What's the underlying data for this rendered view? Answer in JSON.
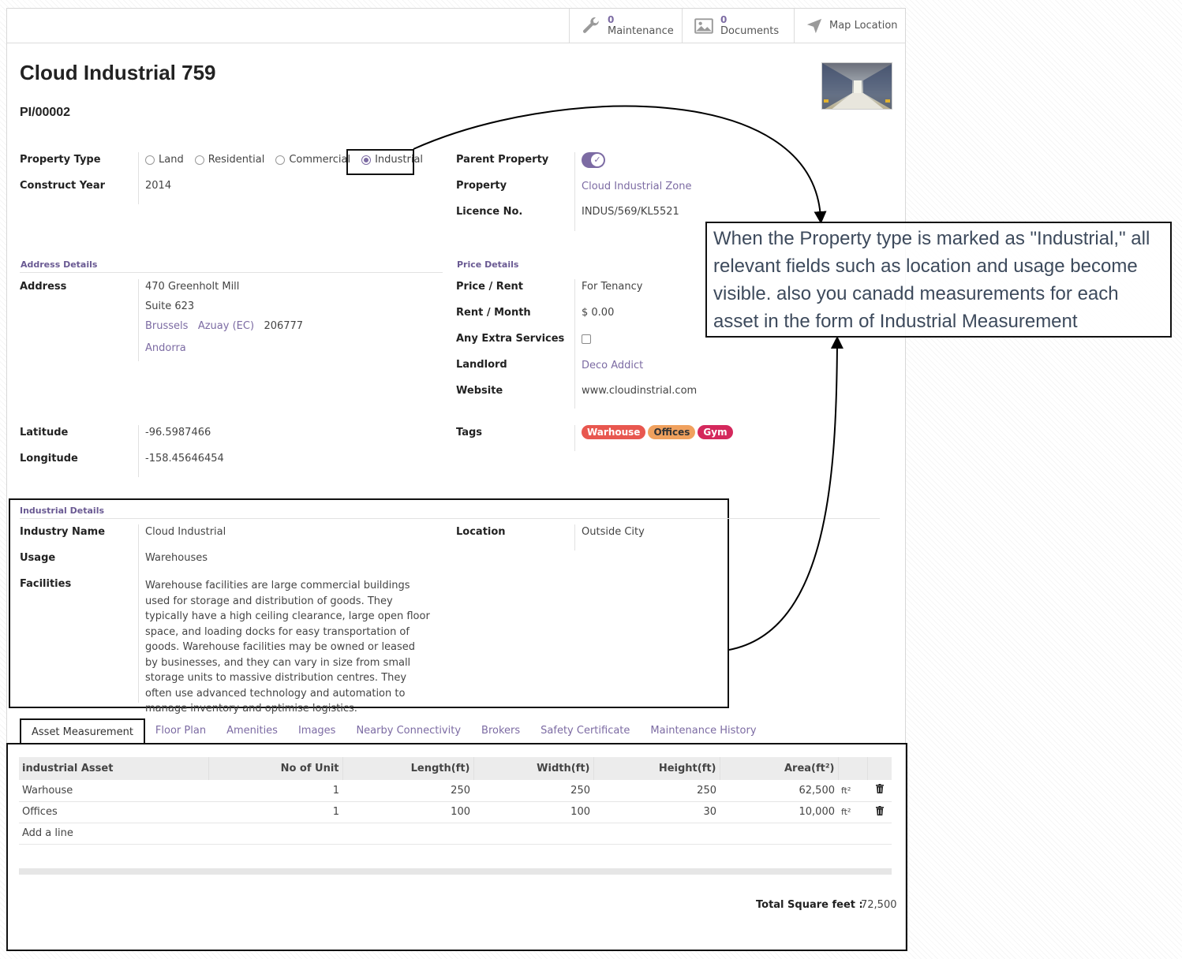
{
  "smart_buttons": [
    {
      "count": "0",
      "label": "Maintenance",
      "icon": "wrench-icon"
    },
    {
      "count": "0",
      "label": "Documents",
      "icon": "image-icon"
    },
    {
      "count": "",
      "label": "Map Location",
      "icon": "location-arrow-icon"
    }
  ],
  "record": {
    "title": "Cloud Industrial 759",
    "reference": "PI/00002"
  },
  "fields": {
    "property_type_label": "Property Type",
    "property_type_options": [
      "Land",
      "Residential",
      "Commercial",
      "Industrial"
    ],
    "property_type_selected": "Industrial",
    "construct_year_label": "Construct Year",
    "construct_year": "2014",
    "parent_property_label": "Parent Property",
    "property_label": "Property",
    "property": "Cloud Industrial Zone",
    "licence_label": "Licence No.",
    "licence": "INDUS/569/KL5521"
  },
  "address": {
    "section": "Address Details",
    "label": "Address",
    "street": "470 Greenholt Mill",
    "street2": "Suite 623",
    "city": "Brussels",
    "state": "Azuay (EC)",
    "zip": "206777",
    "country": "Andorra",
    "latitude_label": "Latitude",
    "latitude": "-96.5987466",
    "longitude_label": "Longitude",
    "longitude": "-158.45646454"
  },
  "price": {
    "section": "Price Details",
    "price_rent_label": "Price / Rent",
    "price_rent": "For Tenancy",
    "rent_month_label": "Rent / Month",
    "rent_month": "$ 0.00",
    "extra_label": "Any Extra Services",
    "landlord_label": "Landlord",
    "landlord": "Deco Addict",
    "website_label": "Website",
    "website": "www.cloudinstrial.com",
    "tags_label": "Tags",
    "tags": [
      {
        "name": "Warhouse",
        "bg": "#e8574f",
        "fg": "#ffffff"
      },
      {
        "name": "Offices",
        "bg": "#f0a15e",
        "fg": "#333333"
      },
      {
        "name": "Gym",
        "bg": "#d4285c",
        "fg": "#ffffff"
      }
    ]
  },
  "industrial": {
    "section": "Industrial Details",
    "industry_name_label": "Industry Name",
    "industry_name": "Cloud Industrial",
    "usage_label": "Usage",
    "usage": "Warehouses",
    "facilities_label": "Facilities",
    "facilities": "Warehouse facilities are large commercial buildings used for storage and distribution of goods. They typically have a high ceiling clearance, large open floor space, and loading docks for easy transportation of goods. Warehouse facilities may be owned or leased by businesses, and they can vary in size from small storage units to massive distribution centres. They often use advanced technology and automation to manage inventory and optimise logistics.",
    "location_label": "Location",
    "location": "Outside City"
  },
  "tabs": [
    "Asset Measurement",
    "Floor Plan",
    "Amenities",
    "Images",
    "Nearby Connectivity",
    "Brokers",
    "Safety Certificate",
    "Maintenance History"
  ],
  "table": {
    "headers": [
      "industrial Asset",
      "No of Unit",
      "Length(ft)",
      "Width(ft)",
      "Height(ft)",
      "Area(ft²)"
    ],
    "rows": [
      {
        "asset": "Warhouse",
        "units": "1",
        "length": "250",
        "width": "250",
        "height": "250",
        "area": "62,500",
        "unit": "ft²"
      },
      {
        "asset": "Offices",
        "units": "1",
        "length": "100",
        "width": "100",
        "height": "30",
        "area": "10,000",
        "unit": "ft²"
      }
    ],
    "add_line": "Add a line"
  },
  "total": {
    "label": "Total Square feet :",
    "value": "72,500"
  },
  "annotation": "When the Property type is marked as \"Industrial,\" all relevant fields such as location and usage become visible. also you canadd measurements for each asset in the form of Industrial Measurement",
  "colors": {
    "accent": "#7c6ba3"
  }
}
